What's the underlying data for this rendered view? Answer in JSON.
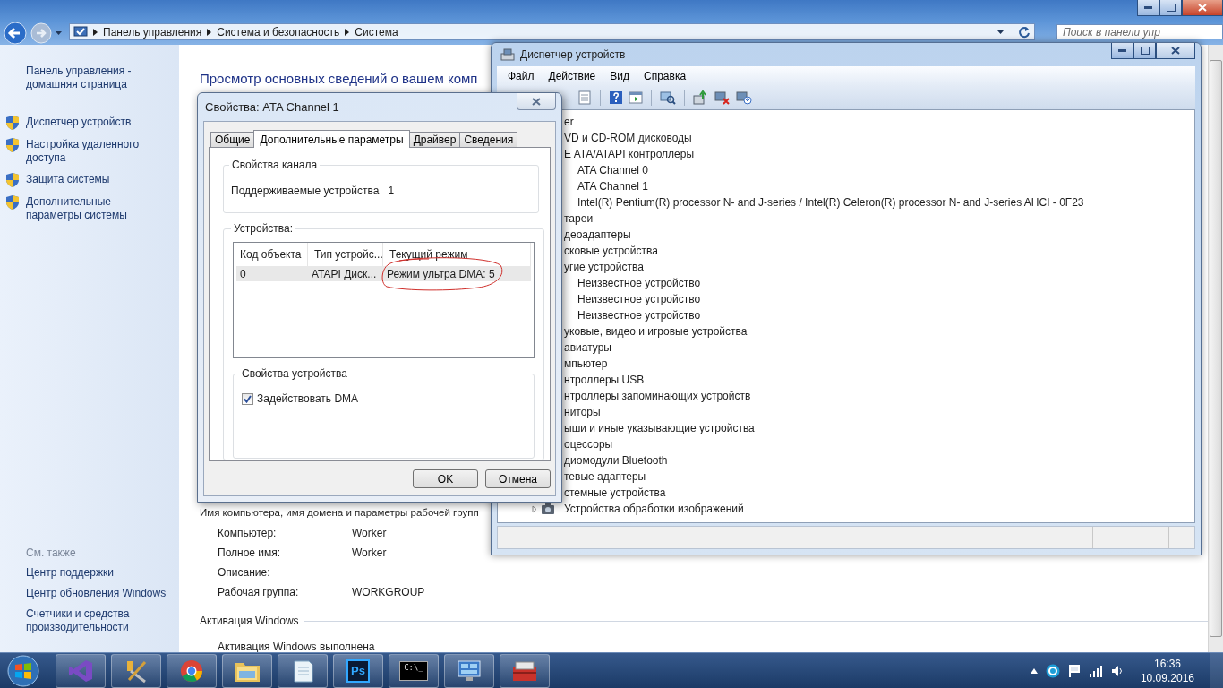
{
  "explorer": {
    "address": [
      "Панель управления",
      "Система и безопасность",
      "Система"
    ],
    "search": {
      "placeholder": "Поиск в панели упр"
    },
    "sidebar": {
      "home_link": "Панель управления - домашняя страница",
      "tasks": [
        "Диспетчер устройств",
        "Настройка удаленного доступа",
        "Защита системы",
        "Дополнительные параметры системы"
      ],
      "see_also_title": "См. также",
      "see_also": [
        "Центр поддержки",
        "Центр обновления Windows",
        "Счетчики и средства производительности"
      ]
    },
    "heading": "Просмотр основных сведений о вашем комп",
    "section_title": "Имя компьютера, имя домена и параметры рабочей групп",
    "properties": [
      {
        "label": "Компьютер:",
        "value": "Worker"
      },
      {
        "label": "Полное имя:",
        "value": "Worker"
      },
      {
        "label": "Описание:"
      },
      {
        "label": "Рабочая группа:",
        "value": "WORKGROUP"
      }
    ],
    "activation_title": "Активация Windows",
    "activation_status": "Активация Windows выполнена"
  },
  "device_manager": {
    "title": "Диспетчер устройств",
    "menu": [
      "Файл",
      "Действие",
      "Вид",
      "Справка"
    ],
    "tree": [
      {
        "label": "er"
      },
      {
        "label": "VD и CD-ROM дисководы"
      },
      {
        "label": "E ATA/ATAPI контроллеры",
        "children": [
          {
            "label": "ATA Channel 0"
          },
          {
            "label": "ATA Channel 1"
          },
          {
            "label": "Intel(R) Pentium(R) processor N- and J-series / Intel(R) Celeron(R) processor N- and J-series AHCI - 0F23"
          }
        ]
      },
      {
        "label": "тареи"
      },
      {
        "label": "деоадаптеры"
      },
      {
        "label": "сковые устройства"
      },
      {
        "label": "угие устройства",
        "children": [
          {
            "label": "Неизвестное устройство"
          },
          {
            "label": "Неизвестное устройство"
          },
          {
            "label": "Неизвестное устройство"
          }
        ]
      },
      {
        "label": "уковые, видео и игровые устройства"
      },
      {
        "label": "авиатуры"
      },
      {
        "label": "мпьютер"
      },
      {
        "label": "нтроллеры USB"
      },
      {
        "label": "нтроллеры запоминающих устройств"
      },
      {
        "label": "ниторы"
      },
      {
        "label": "ыши и иные указывающие устройства"
      },
      {
        "label": "оцессоры"
      },
      {
        "label": "диомодули Bluetooth"
      },
      {
        "label": "тевые адаптеры"
      },
      {
        "label": "стемные устройства"
      },
      {
        "label": "Устройства обработки изображений"
      }
    ]
  },
  "dialog": {
    "title": "Свойства: ATA Channel 1",
    "tabs": [
      {
        "label": "Общие",
        "selected": false
      },
      {
        "label": "Дополнительные параметры",
        "selected": true
      },
      {
        "label": "Драйвер",
        "selected": false
      },
      {
        "label": "Сведения",
        "selected": false
      }
    ],
    "channel_group": {
      "title": "Свойства канала",
      "label": "Поддерживаемые устройства",
      "value": "1"
    },
    "devices_group": {
      "title": "Устройства:",
      "columns": [
        "Код объекта",
        "Тип устройс...",
        "Текущий режим"
      ],
      "rows": [
        {
          "cells": [
            "0",
            "ATAPI Диск...",
            "Режим ультра DMA: 5"
          ],
          "selected": true
        }
      ]
    },
    "device_group": {
      "title": "Свойства устройства",
      "checkbox": {
        "label": "Задействовать DMA",
        "checked": true
      }
    },
    "buttons": [
      "OK",
      "Отмена"
    ]
  },
  "taskbar": {
    "apps": [
      {
        "kind": "ribbon"
      },
      {
        "kind": "tools"
      },
      {
        "kind": "browser"
      },
      {
        "kind": "folder"
      },
      {
        "kind": "notepad"
      },
      {
        "kind": "ps",
        "label": "Ps"
      },
      {
        "kind": "console",
        "label": "C:\\_"
      },
      {
        "kind": "panel"
      },
      {
        "kind": "toolbox"
      }
    ],
    "clock": {
      "time": "16:36",
      "date": "10.09.2016"
    }
  }
}
